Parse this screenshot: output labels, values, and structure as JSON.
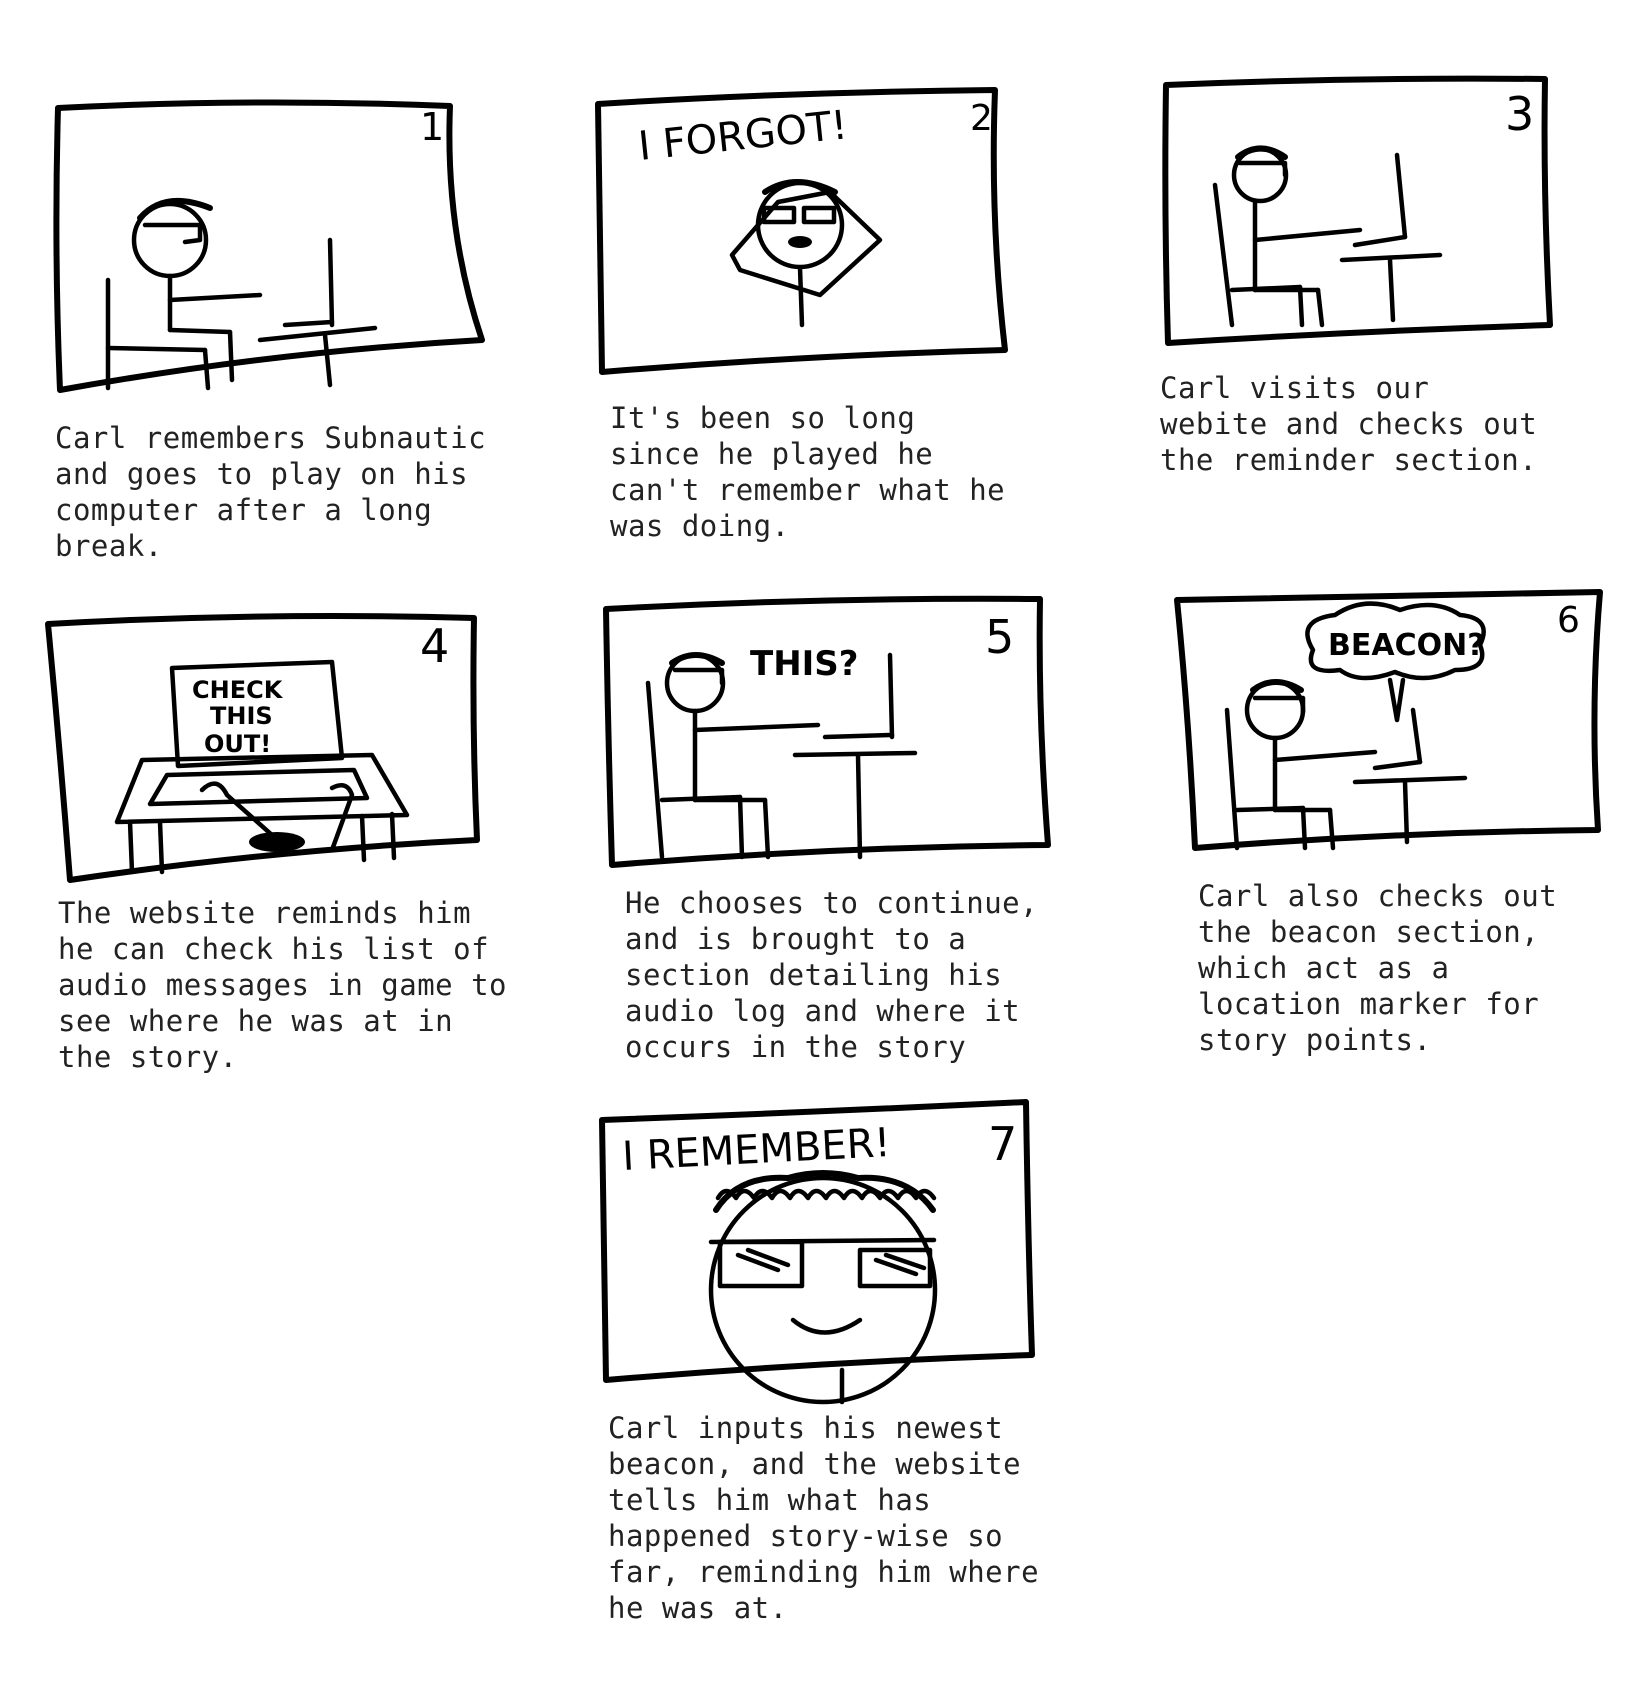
{
  "panels": [
    {
      "number": "1",
      "caption": "Carl remembers Subnautic\nand goes to play on his\ncomputer after a long\nbreak."
    },
    {
      "number": "2",
      "speech": "I FORGOT!",
      "caption": "It's been so long\nsince he played he\ncan't remember what he\nwas doing."
    },
    {
      "number": "3",
      "caption": "Carl visits our\nwebite and checks out\nthe reminder section."
    },
    {
      "number": "4",
      "screen_text": "CHECK\nTHIS\nOUT!",
      "caption": "The website reminds him\nhe can check his list of\naudio messages in game to\nsee where he was at in\nthe story."
    },
    {
      "number": "5",
      "speech": "THIS?",
      "caption": "He chooses to continue,\nand is brought to a\nsection detailing his\naudio log and where it\noccurs in the story"
    },
    {
      "number": "6",
      "speech": "BEACON?",
      "caption": "Carl also checks out\nthe beacon section,\nwhich act as a\nlocation marker for\nstory points."
    },
    {
      "number": "7",
      "speech": "I REMEMBER!",
      "caption": "Carl inputs his newest\nbeacon, and the website\ntells him what has\nhappened story-wise so\nfar, reminding him where\nhe was at."
    }
  ]
}
